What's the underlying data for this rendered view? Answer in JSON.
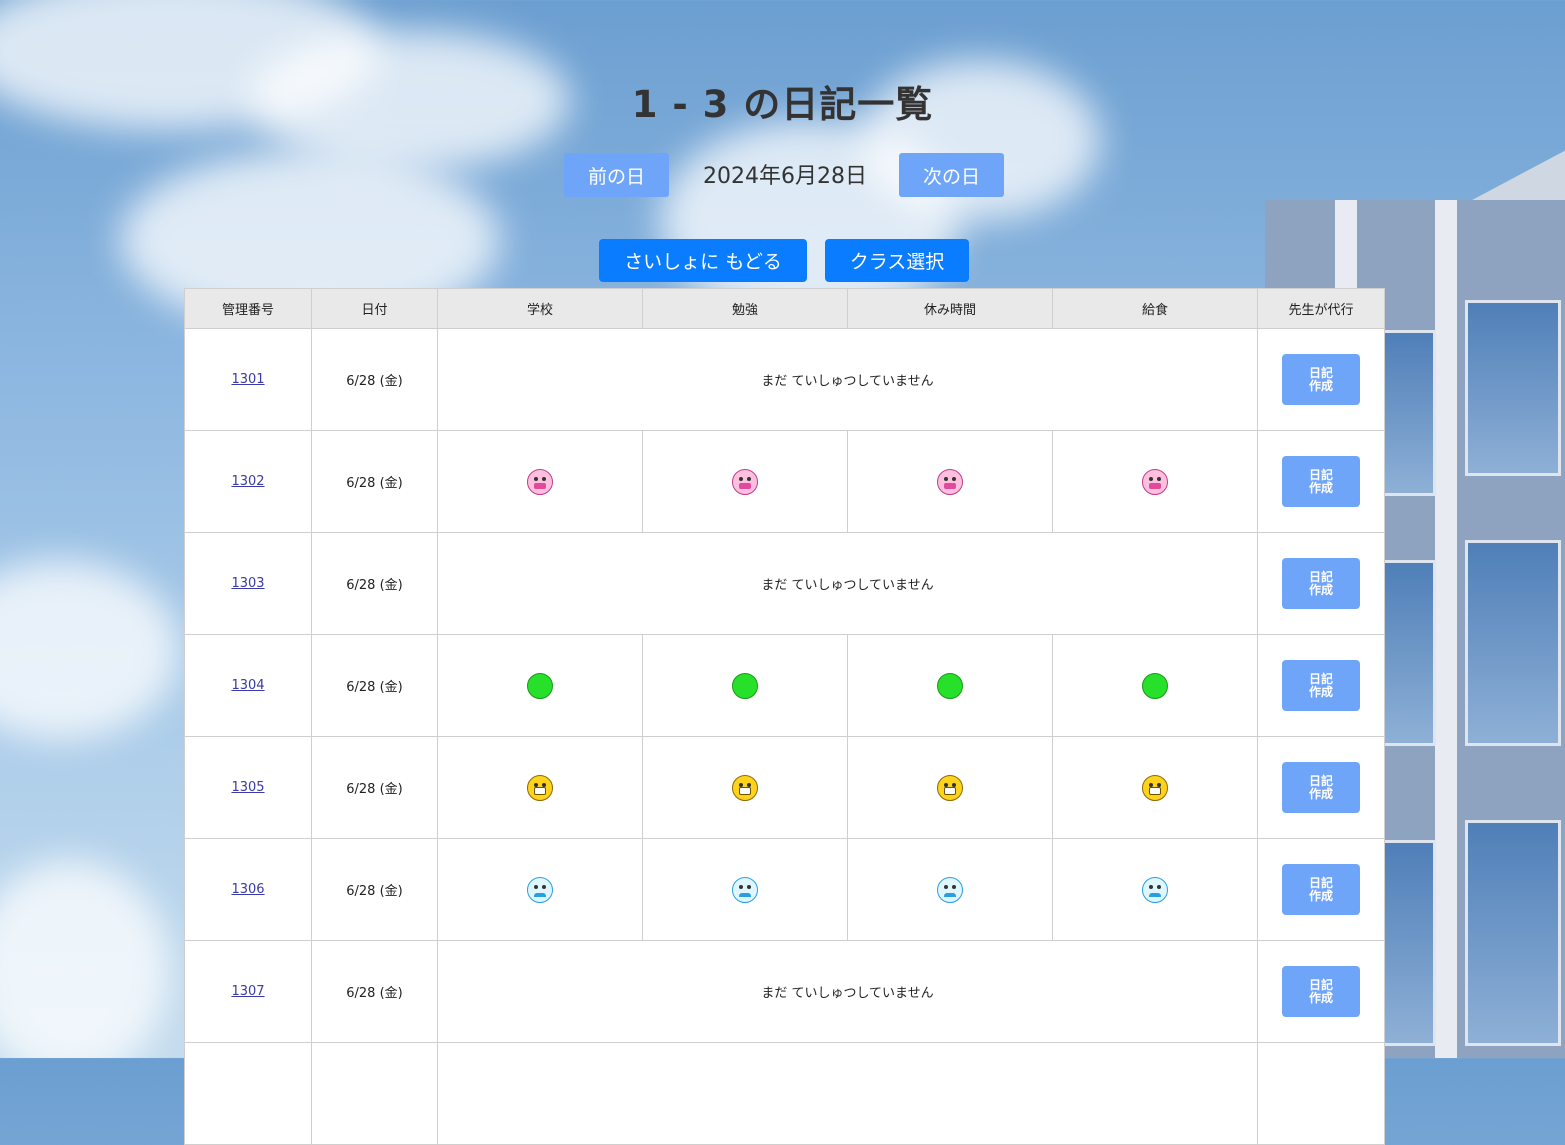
{
  "page": {
    "title": "1 - 3 の日記一覧",
    "current_date": "2024年6月28日",
    "prev_day_label": "前の日",
    "next_day_label": "次の日",
    "back_to_start_label": "さいしょに もどる",
    "class_select_label": "クラス選択"
  },
  "table": {
    "headers": [
      "管理番号",
      "日付",
      "学校",
      "勉強",
      "休み時間",
      "給食",
      "先生が代行"
    ],
    "create_button_label_line1": "日記",
    "create_button_label_line2": "作成",
    "not_submitted_text": "まだ ていしゅつしていません",
    "rows": [
      {
        "id": "1301",
        "date": "6/28 (金)",
        "status": "not_submitted",
        "mood": ""
      },
      {
        "id": "1302",
        "date": "6/28 (金)",
        "status": "submitted",
        "mood": "laughing-face"
      },
      {
        "id": "1303",
        "date": "6/28 (金)",
        "status": "not_submitted",
        "mood": ""
      },
      {
        "id": "1304",
        "date": "6/28 (金)",
        "status": "submitted",
        "mood": "green-circle"
      },
      {
        "id": "1305",
        "date": "6/28 (金)",
        "status": "submitted",
        "mood": "grinning-face"
      },
      {
        "id": "1306",
        "date": "6/28 (金)",
        "status": "submitted",
        "mood": "crying-face"
      },
      {
        "id": "1307",
        "date": "6/28 (金)",
        "status": "not_submitted",
        "mood": ""
      }
    ]
  },
  "colors": {
    "nav_button": "#6fa5f8",
    "main_button": "#0a7cff",
    "link": "#3a3aa8"
  }
}
